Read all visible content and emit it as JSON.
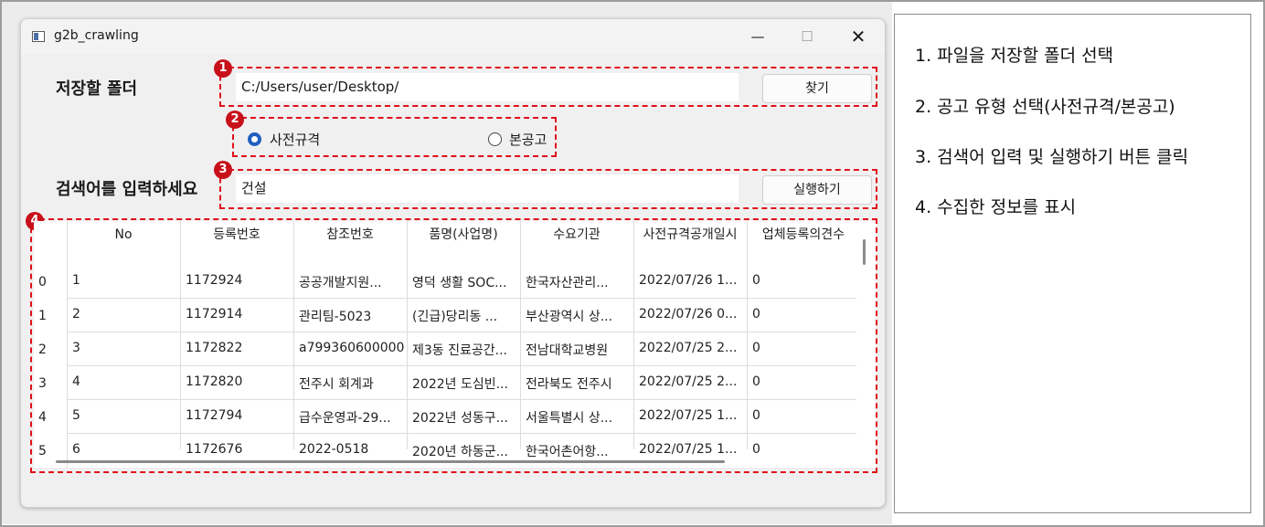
{
  "window": {
    "title": "g2b_crawling",
    "min_icon": "minimize-icon",
    "max_icon": "maximize-icon",
    "close_icon": "close-icon"
  },
  "folder": {
    "label": "저장할 폴더",
    "value": "C:/Users/user/Desktop/",
    "browse_label": "찾기"
  },
  "notice_type": {
    "options": [
      "사전규격",
      "본공고"
    ],
    "selected": "사전규격"
  },
  "search": {
    "label": "검색어를 입력하세요",
    "value": "건설",
    "run_label": "실행하기"
  },
  "markers": [
    "1",
    "2",
    "3",
    "4"
  ],
  "table": {
    "columns": [
      "No",
      "등록번호",
      "참조번호",
      "품명(사업명)",
      "수요기관",
      "사전규격공개일시",
      "업체등록의견수"
    ],
    "rows": [
      {
        "index": "0",
        "cells": [
          "1",
          "1172924",
          "공공개발지원...",
          "영덕 생활 SOC...",
          "한국자산관리...",
          "2022/07/26 1...",
          "0"
        ]
      },
      {
        "index": "1",
        "cells": [
          "2",
          "1172914",
          "관리팀-5023",
          "(긴급)당리동 ...",
          "부산광역시 상...",
          "2022/07/26 0...",
          "0"
        ]
      },
      {
        "index": "2",
        "cells": [
          "3",
          "1172822",
          "a799360600000",
          "제3동 진료공간...",
          "전남대학교병원",
          "2022/07/25 2...",
          "0"
        ]
      },
      {
        "index": "3",
        "cells": [
          "4",
          "1172820",
          "전주시 회계과",
          "2022년 도심빈...",
          "전라북도 전주시",
          "2022/07/25 2...",
          "0"
        ]
      },
      {
        "index": "4",
        "cells": [
          "5",
          "1172794",
          "급수운영과-29...",
          "2022년 성동구...",
          "서울특별시 상...",
          "2022/07/25 1...",
          "0"
        ]
      },
      {
        "index": "5",
        "cells": [
          "6",
          "1172676",
          "2022-0518",
          "2020년 하동군...",
          "한국어촌어항...",
          "2022/07/25 1...",
          "0"
        ]
      }
    ]
  },
  "steps": [
    "1. 파일을 저장할 폴더 선택",
    "2. 공고 유형 선택(사전규격/본공고)",
    "3. 검색어 입력 및 실행하기 버튼 클릭",
    "4. 수집한 정보를 표시"
  ],
  "colors": {
    "annotation_red": "#e0101a",
    "marker_red": "#c8101a",
    "radio_blue": "#1f5fbf"
  }
}
